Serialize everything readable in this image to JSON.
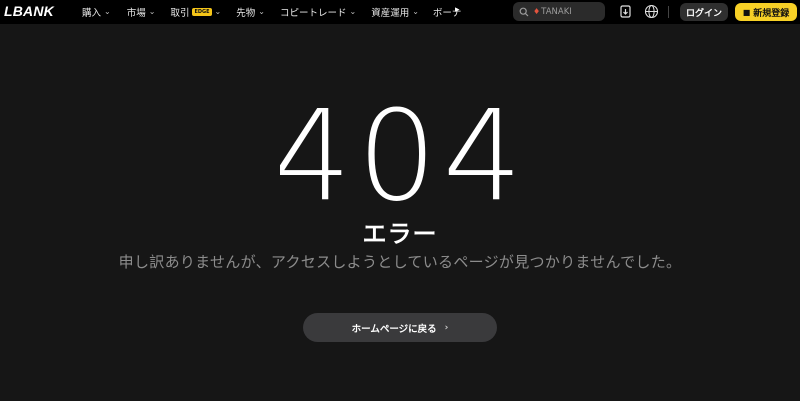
{
  "header": {
    "logo": "LBANK",
    "nav": [
      {
        "label": "購入",
        "chevron": true
      },
      {
        "label": "市場",
        "chevron": true
      },
      {
        "label": "取引",
        "badge": "EDGE",
        "chevron": true
      },
      {
        "label": "先物",
        "chevron": true
      },
      {
        "label": "コピートレード",
        "chevron": true
      },
      {
        "label": "資産運用",
        "chevron": true
      },
      {
        "label": "ボーナ",
        "chevron": false
      }
    ],
    "more_icon": "caret-right-icon",
    "search": {
      "placeholder": "TANAKI",
      "hot_icon": "fire-icon",
      "icon": "search-icon"
    },
    "download_icon": "download-icon",
    "language_icon": "globe-icon",
    "login_label": "ログイン",
    "signup_label": "新規登録",
    "signup_icon": "gift-icon"
  },
  "error": {
    "code": "404",
    "title": "エラー",
    "message": "申し訳ありませんが、アクセスしようとしているページが見つかりませんでした。",
    "home_button": "ホームページに戻る",
    "home_arrow_icon": "chevron-right-icon"
  },
  "colors": {
    "background": "#161616",
    "header": "#000000",
    "accent": "#f7d026",
    "muted_text": "#8c8c8c"
  }
}
